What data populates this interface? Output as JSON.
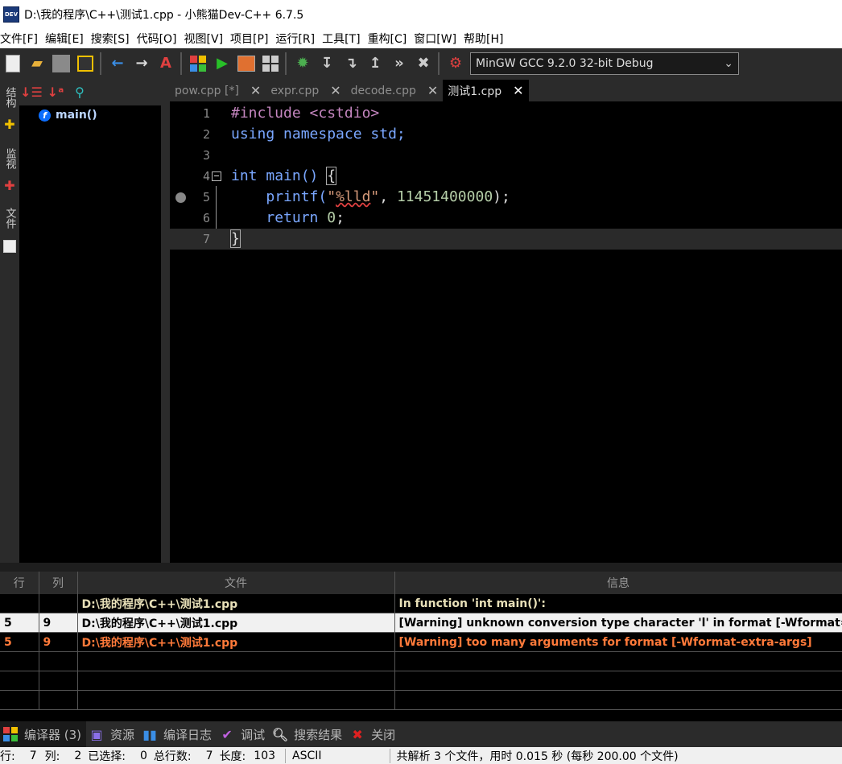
{
  "window": {
    "title": "D:\\我的程序\\C++\\测试1.cpp - 小熊猫Dev-C++ 6.7.5",
    "icon_text": "DEV"
  },
  "menu": [
    "文件[F]",
    "编辑[E]",
    "搜索[S]",
    "代码[O]",
    "视图[V]",
    "项目[P]",
    "运行[R]",
    "工具[T]",
    "重构[C]",
    "窗口[W]",
    "帮助[H]"
  ],
  "toolbar": {
    "compiler": "MinGW GCC 9.2.0 32-bit Debug",
    "dropdown_arrow": "⌄"
  },
  "left_tabs": {
    "structure": "结构",
    "watch": "监视",
    "files": "文件"
  },
  "structure": {
    "items": [
      {
        "icon": "f",
        "label": "main()"
      }
    ]
  },
  "tabs": [
    {
      "label": "pow.cpp [*]",
      "close": "✕"
    },
    {
      "label": "expr.cpp",
      "close": "✕"
    },
    {
      "label": "decode.cpp",
      "close": "✕"
    },
    {
      "label": "测试1.cpp",
      "close": "✕"
    }
  ],
  "editor": {
    "line_numbers": [
      "1",
      "2",
      "3",
      "4",
      "5",
      "6",
      "7"
    ],
    "current_line": 7,
    "breakpoint_line": 5,
    "code": {
      "l1": {
        "directive": "#include",
        "header": "<cstdio>"
      },
      "l2": {
        "using": "using",
        "ns": "namespace",
        "rest": "std;"
      },
      "l4": {
        "type": "int",
        "name": " main() ",
        "brace": "{"
      },
      "l5": {
        "indent": "    ",
        "fn": "printf(",
        "str_open": "\"",
        "fmt": "%lld",
        "str_close": "\"",
        "sep": ", ",
        "num": "11451400000",
        "end": ");"
      },
      "l6": {
        "indent": "    ",
        "kw": "return",
        "sp": " ",
        "num": "0",
        "end": ";"
      },
      "l7": {
        "brace": "}"
      }
    }
  },
  "messages": {
    "headers": {
      "line": "行",
      "col": "列",
      "file": "文件",
      "info": "信息"
    },
    "rows": [
      {
        "line": "",
        "col": "",
        "file": "D:\\我的程序\\C++\\测试1.cpp",
        "info": "In function 'int main()':"
      },
      {
        "line": "5",
        "col": "9",
        "file": "D:\\我的程序\\C++\\测试1.cpp",
        "info": "[Warning] unknown conversion type character 'l' in format [-Wformat=]"
      },
      {
        "line": "5",
        "col": "9",
        "file": "D:\\我的程序\\C++\\测试1.cpp",
        "info": "[Warning] too many arguments for format [-Wformat-extra-args]"
      }
    ]
  },
  "bottom_tabs": [
    {
      "label": "编译器 (3)",
      "icon": "compiler-icon"
    },
    {
      "label": "资源",
      "icon": "resources-icon"
    },
    {
      "label": "编译日志",
      "icon": "compile-log-icon"
    },
    {
      "label": "调试",
      "icon": "debug-check-icon"
    },
    {
      "label": "搜索结果",
      "icon": "search-results-icon"
    },
    {
      "label": "关闭",
      "icon": "close-icon"
    }
  ],
  "status": {
    "line_label": "行:",
    "line": "7",
    "col_label": "列:",
    "col": "2",
    "sel_label": "已选择:",
    "sel": "0",
    "total_label": "总行数:",
    "total": "7",
    "len_label": "长度:",
    "len": "103",
    "encoding": "ASCII",
    "parse": "共解析 3 个文件，用时 0.015 秒 (每秒 200.00 个文件)"
  },
  "colors": {
    "keyword": "#7aa7ff",
    "preprocessor": "#c586c0",
    "string": "#d69a7a",
    "number": "#b5cea8",
    "warning": "#ff7a3a"
  }
}
